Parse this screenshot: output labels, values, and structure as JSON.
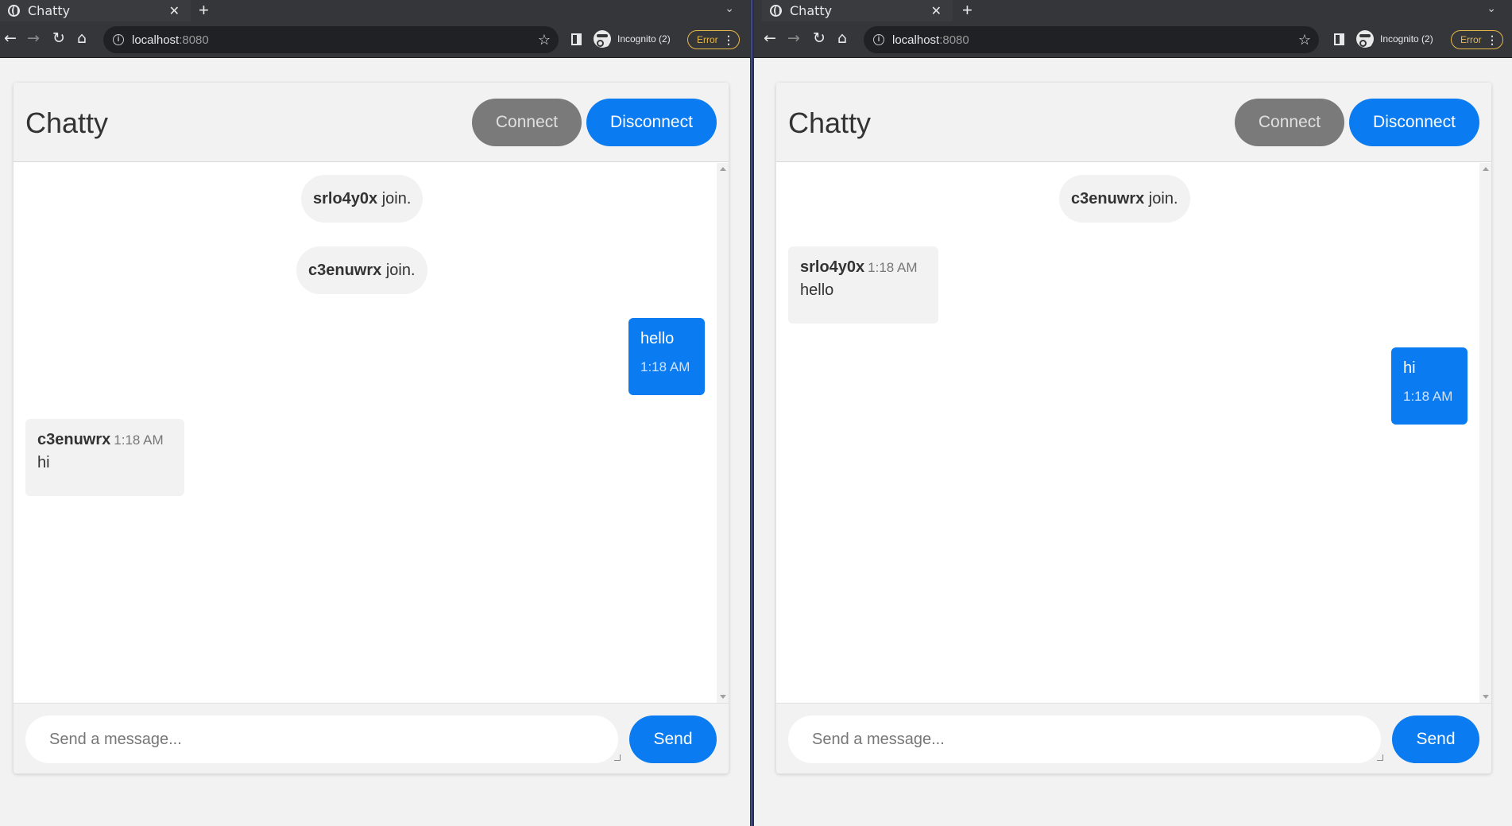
{
  "colors": {
    "accent": "#0a7bf0",
    "connect_button": "#7a7a7a",
    "error": "#e6b84a"
  },
  "browser": {
    "tab_title": "Chatty",
    "new_tab": "+",
    "host": "localhost",
    "port": ":8080",
    "incognito": "Incognito (2)",
    "error": "Error"
  },
  "app": {
    "title": "Chatty",
    "connect": "Connect",
    "disconnect": "Disconnect",
    "placeholder": "Send a message...",
    "send": "Send"
  },
  "window1": {
    "system_messages": [
      {
        "user": "srlo4y0x",
        "text": " join."
      },
      {
        "user": "c3enuwrx",
        "text": " join."
      }
    ],
    "own_message": {
      "text": "hello",
      "time": "1:18 AM"
    },
    "other_message": {
      "user": "c3enuwrx",
      "time": "1:18 AM",
      "text": "hi"
    }
  },
  "window2": {
    "system_messages": [
      {
        "user": "c3enuwrx",
        "text": " join."
      }
    ],
    "other_message": {
      "user": "srlo4y0x",
      "time": "1:18 AM",
      "text": "hello"
    },
    "own_message": {
      "text": "hi",
      "time": "1:18 AM"
    }
  }
}
